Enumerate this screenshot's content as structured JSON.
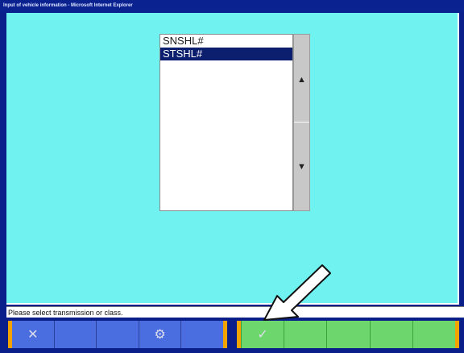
{
  "window": {
    "title": "Input of vehicle information - Microsoft Internet Explorer"
  },
  "list": {
    "items": [
      {
        "label": "SNSHL#",
        "selected": false
      },
      {
        "label": "STSHL#",
        "selected": true
      }
    ]
  },
  "scrollbar": {
    "up_icon": "triangle-up-icon",
    "down_icon": "triangle-down-icon"
  },
  "status": {
    "message": "Please select transmission or class."
  },
  "toolbar": {
    "left_buttons": [
      {
        "icon": "cancel-icon",
        "glyph": "✕"
      },
      {
        "icon": "",
        "glyph": ""
      },
      {
        "icon": "",
        "glyph": ""
      },
      {
        "icon": "print-icon",
        "glyph": "⚙"
      },
      {
        "icon": "",
        "glyph": ""
      }
    ],
    "right_buttons": [
      {
        "icon": "checkmark-icon",
        "glyph": "✓"
      },
      {
        "icon": "",
        "glyph": ""
      },
      {
        "icon": "",
        "glyph": ""
      },
      {
        "icon": "",
        "glyph": ""
      },
      {
        "icon": "",
        "glyph": ""
      }
    ]
  },
  "colors": {
    "background": "#6ff2f0",
    "selected": "#0c1f6e",
    "left_group": "#4a6ee0",
    "right_group": "#6dd66d",
    "accent": "#f2a300"
  }
}
